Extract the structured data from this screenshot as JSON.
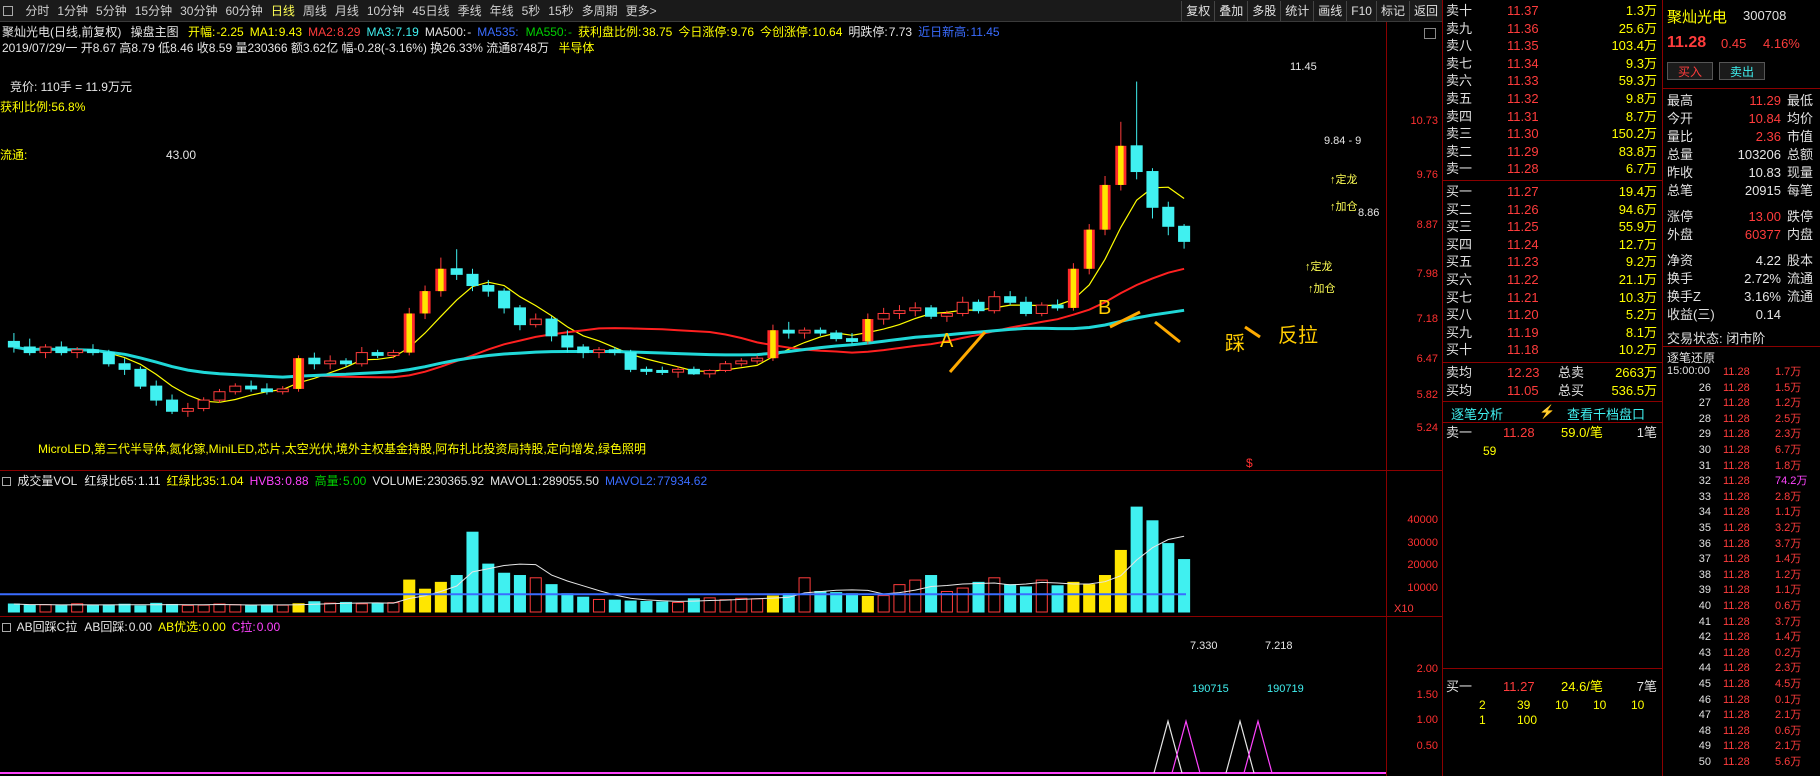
{
  "toolbar": {
    "periods": [
      "分时",
      "1分钟",
      "5分钟",
      "15分钟",
      "30分钟",
      "60分钟",
      "日线",
      "周线",
      "月线",
      "10分钟",
      "45日线",
      "季线",
      "年线",
      "5秒",
      "15秒",
      "多周期",
      "更多>"
    ],
    "active_period": "日线",
    "right_buttons": [
      "复权",
      "叠加",
      "多股",
      "统计",
      "画线",
      "F10",
      "标记",
      "返回"
    ]
  },
  "chart_header": {
    "title": "聚灿光电(日线,前复权)",
    "formula": "操盘主图",
    "items": [
      {
        "label": "开幅:",
        "value": "-2.25",
        "color": "#ffff00"
      },
      {
        "label": "MA1:",
        "value": "9.43",
        "color": "#ffff00"
      },
      {
        "label": "MA2:",
        "value": "8.29",
        "color": "#ff3c3c"
      },
      {
        "label": "MA3:",
        "value": "7.19",
        "color": "#40f0f0"
      },
      {
        "label": "MA500:",
        "value": "-",
        "color": "#e6e6e6"
      },
      {
        "label": "MA535:",
        "value": "",
        "color": "#3a6cff"
      },
      {
        "label": "MA550:",
        "value": "-",
        "color": "#00d000"
      },
      {
        "label": "获利盘比例:",
        "value": "38.75",
        "color": "#ffff00"
      },
      {
        "label": "今日涨停:",
        "value": "9.76",
        "color": "#ffff00"
      },
      {
        "label": "今创涨停:",
        "value": "10.64",
        "color": "#ffff00"
      },
      {
        "label": "明跌停:",
        "value": "7.73",
        "color": "#e6e6e6"
      },
      {
        "label": "近日新高:",
        "value": "11.45",
        "color": "#3a6cff"
      }
    ],
    "ohlc_line": "2019/07/29/一 开8.67 高8.79 低8.46 收8.59 量230366 额3.62亿 幅-0.28(-3.16%) 换26.33% 流通8748万",
    "sector": "半导体"
  },
  "overlays": {
    "bid_note": "竞价: 110手 = 11.9万元",
    "profit_ratio": "获利比例:56.8%",
    "float_label": "流通:",
    "float_value": "43.00",
    "concepts": "MicroLED,第三代半导体,氮化镓,MiniLED,芯片,太空光伏,境外主权基金持股,阿布扎比投资局持股,定向增发,绿色照明",
    "high_label": "11.45",
    "last_label": "9.84 - 9",
    "level_label": "8.86",
    "annotations": [
      "A",
      "B",
      "踩",
      "反拉",
      "↑定龙",
      "↑加仓",
      "↑定龙",
      "↑加仓"
    ],
    "dollar": "$"
  },
  "price_axis": [
    "10.73",
    "9.76",
    "8.87",
    "7.98",
    "7.18",
    "6.47",
    "5.82",
    "5.24"
  ],
  "chart_data": [
    {
      "type": "candlestick",
      "title": "聚灿光电(日线,前复权)",
      "ylim": [
        5.0,
        11.8
      ],
      "y_ticks": [
        10.73,
        9.76,
        8.87,
        7.98,
        7.18,
        6.47,
        5.82,
        5.24
      ],
      "candles": [
        [
          6.8,
          6.95,
          6.6,
          6.7
        ],
        [
          6.7,
          6.85,
          6.55,
          6.6
        ],
        [
          6.6,
          6.75,
          6.5,
          6.7
        ],
        [
          6.7,
          6.8,
          6.55,
          6.6
        ],
        [
          6.6,
          6.7,
          6.5,
          6.65
        ],
        [
          6.65,
          6.75,
          6.55,
          6.6
        ],
        [
          6.6,
          6.65,
          6.35,
          6.4
        ],
        [
          6.4,
          6.5,
          6.2,
          6.3
        ],
        [
          6.3,
          6.35,
          5.95,
          6.0
        ],
        [
          6.0,
          6.1,
          5.65,
          5.75
        ],
        [
          5.75,
          5.85,
          5.5,
          5.55
        ],
        [
          5.55,
          5.7,
          5.45,
          5.6
        ],
        [
          5.6,
          5.8,
          5.55,
          5.75
        ],
        [
          5.75,
          5.95,
          5.7,
          5.9
        ],
        [
          5.9,
          6.05,
          5.85,
          6.0
        ],
        [
          6.0,
          6.1,
          5.9,
          5.95
        ],
        [
          5.95,
          6.05,
          5.85,
          5.9
        ],
        [
          5.9,
          6.0,
          5.85,
          5.95
        ],
        [
          5.95,
          6.55,
          5.9,
          6.5
        ],
        [
          6.5,
          6.6,
          6.3,
          6.4
        ],
        [
          6.4,
          6.55,
          6.3,
          6.45
        ],
        [
          6.45,
          6.5,
          6.35,
          6.4
        ],
        [
          6.4,
          6.7,
          6.35,
          6.6
        ],
        [
          6.6,
          6.65,
          6.5,
          6.55
        ],
        [
          6.55,
          6.65,
          6.5,
          6.6
        ],
        [
          6.6,
          7.4,
          6.55,
          7.3
        ],
        [
          7.3,
          7.8,
          7.2,
          7.7
        ],
        [
          7.7,
          8.3,
          7.6,
          8.1
        ],
        [
          8.1,
          8.45,
          7.9,
          8.0
        ],
        [
          8.0,
          8.1,
          7.7,
          7.8
        ],
        [
          7.8,
          7.9,
          7.6,
          7.7
        ],
        [
          7.7,
          7.75,
          7.3,
          7.4
        ],
        [
          7.4,
          7.45,
          7.0,
          7.1
        ],
        [
          7.1,
          7.3,
          7.05,
          7.2
        ],
        [
          7.2,
          7.25,
          6.8,
          6.9
        ],
        [
          6.9,
          7.0,
          6.6,
          6.7
        ],
        [
          6.7,
          6.75,
          6.5,
          6.6
        ],
        [
          6.6,
          6.7,
          6.5,
          6.65
        ],
        [
          6.65,
          6.7,
          6.55,
          6.6
        ],
        [
          6.6,
          6.65,
          6.25,
          6.3
        ],
        [
          6.3,
          6.35,
          6.2,
          6.28
        ],
        [
          6.28,
          6.35,
          6.2,
          6.25
        ],
        [
          6.25,
          6.35,
          6.15,
          6.3
        ],
        [
          6.3,
          6.35,
          6.2,
          6.22
        ],
        [
          6.22,
          6.3,
          6.15,
          6.28
        ],
        [
          6.28,
          6.45,
          6.25,
          6.4
        ],
        [
          6.4,
          6.5,
          6.35,
          6.45
        ],
        [
          6.45,
          6.55,
          6.4,
          6.5
        ],
        [
          6.5,
          7.1,
          6.45,
          7.0
        ],
        [
          7.0,
          7.15,
          6.85,
          6.95
        ],
        [
          6.95,
          7.05,
          6.85,
          7.0
        ],
        [
          7.0,
          7.05,
          6.9,
          6.95
        ],
        [
          6.95,
          7.0,
          6.8,
          6.85
        ],
        [
          6.85,
          6.95,
          6.75,
          6.8
        ],
        [
          6.8,
          7.3,
          6.75,
          7.2
        ],
        [
          7.2,
          7.4,
          7.1,
          7.3
        ],
        [
          7.3,
          7.45,
          7.2,
          7.35
        ],
        [
          7.35,
          7.5,
          7.25,
          7.4
        ],
        [
          7.4,
          7.45,
          7.2,
          7.25
        ],
        [
          7.25,
          7.35,
          7.15,
          7.3
        ],
        [
          7.3,
          7.6,
          7.25,
          7.5
        ],
        [
          7.5,
          7.55,
          7.3,
          7.35
        ],
        [
          7.35,
          7.7,
          7.3,
          7.6
        ],
        [
          7.6,
          7.7,
          7.45,
          7.5
        ],
        [
          7.5,
          7.6,
          7.25,
          7.3
        ],
        [
          7.3,
          7.5,
          7.25,
          7.45
        ],
        [
          7.45,
          7.55,
          7.35,
          7.4
        ],
        [
          7.4,
          8.2,
          7.35,
          8.1
        ],
        [
          8.1,
          8.9,
          8.0,
          8.8
        ],
        [
          8.8,
          9.76,
          8.7,
          9.6
        ],
        [
          9.6,
          10.73,
          9.5,
          10.3
        ],
        [
          10.3,
          11.45,
          9.7,
          9.84
        ],
        [
          9.84,
          9.9,
          9.0,
          9.2
        ],
        [
          9.2,
          9.3,
          8.7,
          8.86
        ],
        [
          8.86,
          8.9,
          8.46,
          8.59
        ]
      ]
    },
    {
      "type": "bar",
      "title": "成交量VOL",
      "ylim": [
        0,
        50000
      ],
      "y_ticks": [
        40000,
        30000,
        20000,
        10000
      ],
      "values": [
        3500,
        3000,
        3200,
        2800,
        3600,
        2900,
        3100,
        3400,
        2700,
        3800,
        3300,
        2900,
        3000,
        3500,
        3200,
        2800,
        3100,
        3000,
        3600,
        4500,
        3900,
        4200,
        3600,
        3800,
        4100,
        14000,
        10000,
        13000,
        16000,
        35000,
        21000,
        17000,
        16000,
        15000,
        12000,
        8000,
        6500,
        5500,
        5200,
        4800,
        4600,
        4400,
        4200,
        5800,
        6200,
        5400,
        6000,
        5800,
        7000,
        8000,
        15000,
        9000,
        8500,
        8000,
        6800,
        7200,
        12000,
        14000,
        16000,
        9000,
        10500,
        13000,
        15000,
        12000,
        11000,
        14000,
        11500,
        13000,
        12000,
        16000,
        27000,
        46000,
        40000,
        30000,
        23000
      ]
    },
    {
      "type": "line",
      "title": "AB回踩C拉",
      "ylim": [
        0,
        2.6
      ],
      "y_ticks": [
        2.0,
        1.5,
        1.0,
        0.5
      ],
      "labels": [
        "7.330",
        "190715",
        "7.218",
        "190719"
      ]
    }
  ],
  "volume_header": {
    "items": [
      {
        "label": "成交量VOL",
        "value": "",
        "color": "#e6e6e6"
      },
      {
        "label": "红绿比65:",
        "value": "1.11",
        "color": "#e6e6e6"
      },
      {
        "label": "红绿比35:",
        "value": "1.04",
        "color": "#ffff00"
      },
      {
        "label": "HVB3:",
        "value": "0.88",
        "color": "#ff44ff"
      },
      {
        "label": "高量:",
        "value": "5.00",
        "color": "#00d000"
      },
      {
        "label": "VOLUME:",
        "value": "230365.92",
        "color": "#e6e6e6"
      },
      {
        "label": "MAVOL1:",
        "value": "289055.50",
        "color": "#e6e6e6"
      },
      {
        "label": "MAVOL2:",
        "value": "77934.62",
        "color": "#3a6cff"
      }
    ],
    "unit": "X10"
  },
  "volume_axis": [
    "40000",
    "30000",
    "20000",
    "10000"
  ],
  "ab_header": {
    "items": [
      {
        "label": "AB回踩C拉",
        "value": "",
        "color": "#e6e6e6"
      },
      {
        "label": "AB回踩:",
        "value": "0.00",
        "color": "#e6e6e6"
      },
      {
        "label": "AB优选:",
        "value": "0.00",
        "color": "#ffff00"
      },
      {
        "label": "C拉:",
        "value": "0.00",
        "color": "#ff44ff"
      }
    ]
  },
  "ab_axis": [
    "2.00",
    "1.50",
    "1.00",
    "0.50"
  ],
  "ab_labels": {
    "v1": "7.330",
    "d1": "190715",
    "v2": "7.218",
    "d2": "190719"
  },
  "order_book": {
    "asks": [
      {
        "label": "卖十",
        "price": "11.37",
        "qty": "1.3万"
      },
      {
        "label": "卖九",
        "price": "11.36",
        "qty": "25.6万"
      },
      {
        "label": "卖八",
        "price": "11.35",
        "qty": "103.4万"
      },
      {
        "label": "卖七",
        "price": "11.34",
        "qty": "9.3万"
      },
      {
        "label": "卖六",
        "price": "11.33",
        "qty": "59.3万"
      },
      {
        "label": "卖五",
        "price": "11.32",
        "qty": "9.8万"
      },
      {
        "label": "卖四",
        "price": "11.31",
        "qty": "8.7万"
      },
      {
        "label": "卖三",
        "price": "11.30",
        "qty": "150.2万"
      },
      {
        "label": "卖二",
        "price": "11.29",
        "qty": "83.8万"
      },
      {
        "label": "卖一",
        "price": "11.28",
        "qty": "6.7万"
      }
    ],
    "bids": [
      {
        "label": "买一",
        "price": "11.27",
        "qty": "19.4万"
      },
      {
        "label": "买二",
        "price": "11.26",
        "qty": "94.6万"
      },
      {
        "label": "买三",
        "price": "11.25",
        "qty": "55.9万"
      },
      {
        "label": "买四",
        "price": "11.24",
        "qty": "12.7万"
      },
      {
        "label": "买五",
        "price": "11.23",
        "qty": "9.2万"
      },
      {
        "label": "买六",
        "price": "11.22",
        "qty": "21.1万"
      },
      {
        "label": "买七",
        "price": "11.21",
        "qty": "10.3万"
      },
      {
        "label": "买八",
        "price": "11.20",
        "qty": "5.2万"
      },
      {
        "label": "买九",
        "price": "11.19",
        "qty": "8.1万"
      },
      {
        "label": "买十",
        "price": "11.18",
        "qty": "10.2万"
      }
    ],
    "avg_rows": [
      {
        "label": "卖均",
        "price": "12.23",
        "label2": "总卖",
        "qty": "2663万"
      },
      {
        "label": "买均",
        "price": "11.05",
        "label2": "总买",
        "qty": "536.5万"
      }
    ],
    "tab1": "逐笔分析",
    "tab2": "查看千档盘口",
    "ask1_line": {
      "label": "卖一",
      "price": "11.28",
      "qty": "59.0/笔",
      "count": "1笔"
    },
    "ask1_detail": "59",
    "bid1_line": {
      "label": "买一",
      "price": "11.27",
      "qty": "24.6/笔",
      "count": "7笔"
    },
    "bid1_detail1": [
      "2",
      "39",
      "10",
      "10",
      "10"
    ],
    "bid1_detail2": [
      "1",
      "100"
    ],
    "ask_suffix": "¥"
  },
  "quote": {
    "name": "聚灿光电",
    "code": "300708",
    "price": "11.28",
    "change": "0.45",
    "pct": "4.16%",
    "buy_label": "买入",
    "sell_label": "卖出",
    "rows": [
      {
        "k": "最高",
        "v": "11.29",
        "k2": "最低",
        "c": "#ff3c3c"
      },
      {
        "k": "今开",
        "v": "10.84",
        "k2": "均价",
        "c": "#ff3c3c"
      },
      {
        "k": "量比",
        "v": "2.36",
        "k2": "市值",
        "c": "#ff3c3c"
      },
      {
        "k": "总量",
        "v": "103206",
        "k2": "总额",
        "c": "#e6e6e6"
      },
      {
        "k": "昨收",
        "v": "10.83",
        "k2": "现量",
        "c": "#e6e6e6"
      },
      {
        "k": "总笔",
        "v": "20915",
        "k2": "每笔",
        "c": "#e6e6e6"
      },
      {
        "k": "涨停",
        "v": "13.00",
        "k2": "跌停",
        "c": "#ff3c3c"
      },
      {
        "k": "外盘",
        "v": "60377",
        "k2": "内盘",
        "c": "#ff3c3c"
      },
      {
        "k": "净资",
        "v": "4.22",
        "k2": "股本",
        "c": "#e6e6e6"
      },
      {
        "k": "换手",
        "v": "2.72%",
        "k2": "流通",
        "c": "#e6e6e6"
      },
      {
        "k": "换手Z",
        "v": "3.16%",
        "k2": "流通",
        "c": "#e6e6e6"
      },
      {
        "k": "收益(三)",
        "v": "0.14",
        "k2": "",
        "c": "#e6e6e6"
      }
    ],
    "status": "交易状态: 闭市阶",
    "trades_title": "逐笔还原",
    "trades_time": "15:00:00",
    "trades": [
      {
        "n": "",
        "p": "11.28",
        "q": "1.7万",
        "c": "#ff3c3c"
      },
      {
        "n": "26",
        "p": "11.28",
        "q": "1.5万",
        "c": "#ff3c3c"
      },
      {
        "n": "27",
        "p": "11.28",
        "q": "1.2万",
        "c": "#ff3c3c"
      },
      {
        "n": "28",
        "p": "11.28",
        "q": "2.5万",
        "c": "#ff3c3c"
      },
      {
        "n": "29",
        "p": "11.28",
        "q": "2.3万",
        "c": "#ff3c3c"
      },
      {
        "n": "30",
        "p": "11.28",
        "q": "6.7万",
        "c": "#ff3c3c"
      },
      {
        "n": "31",
        "p": "11.28",
        "q": "1.8万",
        "c": "#ff3c3c"
      },
      {
        "n": "32",
        "p": "11.28",
        "q": "74.2万",
        "c": "#ff44ff"
      },
      {
        "n": "33",
        "p": "11.28",
        "q": "2.8万",
        "c": "#ff3c3c"
      },
      {
        "n": "34",
        "p": "11.28",
        "q": "1.1万",
        "c": "#ff3c3c"
      },
      {
        "n": "35",
        "p": "11.28",
        "q": "3.2万",
        "c": "#ff3c3c"
      },
      {
        "n": "36",
        "p": "11.28",
        "q": "3.7万",
        "c": "#ff3c3c"
      },
      {
        "n": "37",
        "p": "11.28",
        "q": "1.4万",
        "c": "#ff3c3c"
      },
      {
        "n": "38",
        "p": "11.28",
        "q": "1.2万",
        "c": "#ff3c3c"
      },
      {
        "n": "39",
        "p": "11.28",
        "q": "1.1万",
        "c": "#ff3c3c"
      },
      {
        "n": "40",
        "p": "11.28",
        "q": "0.6万",
        "c": "#ff3c3c"
      },
      {
        "n": "41",
        "p": "11.28",
        "q": "3.7万",
        "c": "#ff3c3c"
      },
      {
        "n": "42",
        "p": "11.28",
        "q": "1.4万",
        "c": "#ff3c3c"
      },
      {
        "n": "43",
        "p": "11.28",
        "q": "0.2万",
        "c": "#ff3c3c"
      },
      {
        "n": "44",
        "p": "11.28",
        "q": "2.3万",
        "c": "#ff3c3c"
      },
      {
        "n": "45",
        "p": "11.28",
        "q": "4.5万",
        "c": "#ff3c3c"
      },
      {
        "n": "46",
        "p": "11.28",
        "q": "0.1万",
        "c": "#ff3c3c"
      },
      {
        "n": "47",
        "p": "11.28",
        "q": "2.1万",
        "c": "#ff3c3c"
      },
      {
        "n": "48",
        "p": "11.28",
        "q": "0.6万",
        "c": "#ff3c3c"
      },
      {
        "n": "49",
        "p": "11.28",
        "q": "2.1万",
        "c": "#ff3c3c"
      },
      {
        "n": "50",
        "p": "11.28",
        "q": "5.6万",
        "c": "#ff3c3c"
      }
    ]
  },
  "colors": {
    "up": "#ff3c3c",
    "down": "#40f0f0",
    "ma1": "#ffff00",
    "ma2": "#ff2020",
    "ma3": "#20d8d8",
    "divider": "#8b0000"
  }
}
